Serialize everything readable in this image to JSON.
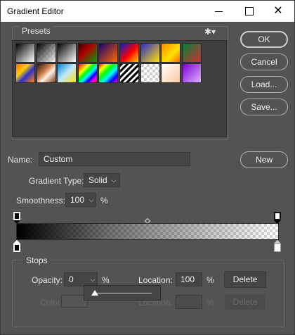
{
  "window": {
    "title": "Gradient Editor"
  },
  "presets": {
    "label": "Presets",
    "gear_icon": "gear-icon",
    "swatches_row1": [
      "linear-gradient(135deg,#000 0%,#fff 100%)",
      "linear-gradient(135deg,#000 0%,rgba(255,255,255,0.6) 100%),repeating-conic-gradient(#fff 0% 25%,#ccc 0% 50%) 0 0/8px 8px",
      "linear-gradient(135deg,#000 0%,#fff 100%)",
      "linear-gradient(135deg,#3a0000 0%,#b00000 40%,#00a000 100%)",
      "linear-gradient(135deg,#180070 0%,#ff6a00 100%)",
      "linear-gradient(135deg,#0020d0 0%,#ff0000 55%,#ffd000 100%)",
      "linear-gradient(135deg,#2a2ad0 0%,#ffe000 100%)",
      "linear-gradient(135deg,#ff8a00 0%,#ffe000 60%,#ff6a00 100%)",
      "linear-gradient(135deg,#00803a 0%,#d03030 100%)"
    ],
    "swatches_row2": [
      "linear-gradient(135deg,#ff6a00 0%,#ffd000 35%,#3030d0 60%,#ff8a00 100%)",
      "linear-gradient(135deg,#2a1a10 0%,#d08050 40%,#fff0e0 60%,#7a3a20 100%)",
      "linear-gradient(135deg,#0080d0 0%,#c0e8ff 50%,#ffe000 100%)",
      "linear-gradient(135deg,#ff0000,#ff8000,#ffff00,#00ff00,#00ffff,#0000ff,#ff00ff,#ff0000)",
      "linear-gradient(135deg,#ff0000,#ffff00,#00ff00,#00ffff,#0000ff,#ff00ff)",
      "repeating-linear-gradient(135deg,#000 0px,#000 3px,#fff 3px,#fff 6px)",
      "repeating-conic-gradient(#fff 0% 25%,#cfcfcf 0% 50%) 0 0/8px 8px",
      "linear-gradient(135deg,#ffffff 0%,#ffc8a0 100%)",
      "linear-gradient(135deg,#7a00d0 0%,#e0b0ff 100%)"
    ]
  },
  "buttons": {
    "ok": "OK",
    "cancel": "Cancel",
    "load": "Load...",
    "save": "Save...",
    "new": "New",
    "delete": "Delete"
  },
  "name": {
    "label": "Name:",
    "value": "Custom"
  },
  "gradient_type": {
    "label": "Gradient Type:",
    "value": "Solid"
  },
  "smoothness": {
    "label": "Smoothness:",
    "value": "100",
    "unit": "%"
  },
  "stops": {
    "title": "Stops",
    "opacity": {
      "label": "Opacity:",
      "value": "0",
      "unit": "%"
    },
    "location": {
      "label": "Location:",
      "value": "100",
      "unit": "%"
    },
    "color": {
      "label": "Color:"
    },
    "location2": {
      "label": "Location:",
      "unit": "%"
    },
    "slider_value": 0
  },
  "colors": {
    "panel": "#535353",
    "field": "#454545",
    "text": "#e6e6e6"
  }
}
